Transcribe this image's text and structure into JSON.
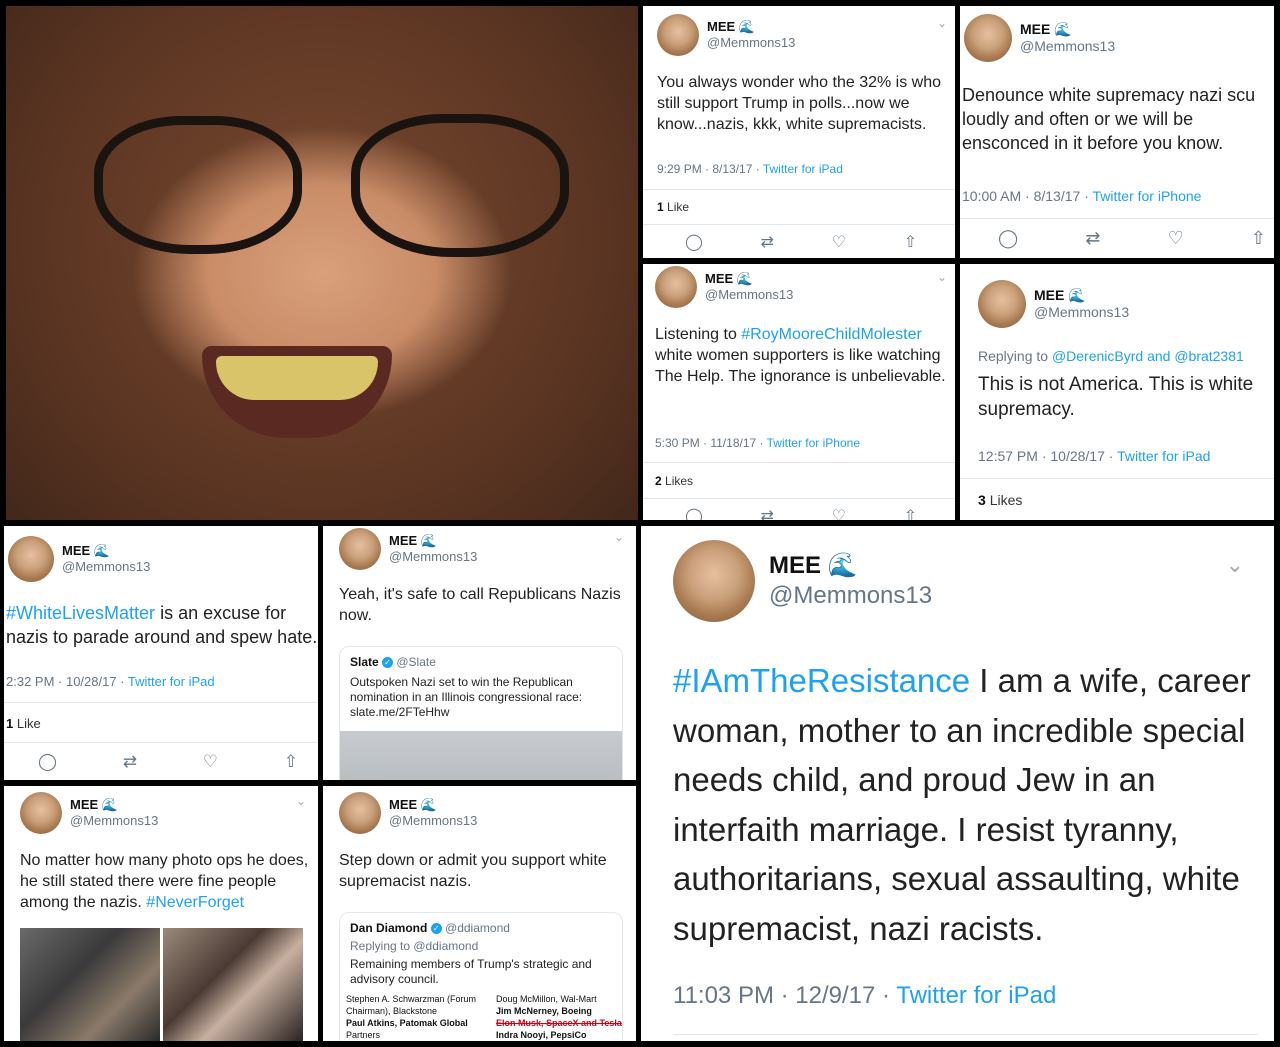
{
  "user": {
    "name": "MEE",
    "handle": "@Memmons13",
    "wave": "🌊"
  },
  "t1": {
    "text": "You always wonder who the 32% is who still support Trump in polls...now we know...nazis, kkk, white supremacists.",
    "time": "9:29 PM · 8/13/17 · ",
    "source": "Twitter for iPad",
    "likes_count": "1",
    "likes_label": "Like"
  },
  "t2": {
    "text": "Denounce white supremacy nazi scu loudly and often or we will be ensconced in it before you know.",
    "time": "10:00 AM · 8/13/17 · ",
    "source": "Twitter for iPhone"
  },
  "t3": {
    "tag": "#RoyMooreChildMolester",
    "pre": "Listening to ",
    "post": " white women supporters is like watching The Help. The ignorance is unbelievable.",
    "time": "5:30 PM · 11/18/17 · ",
    "source": "Twitter for iPhone",
    "likes_count": "2",
    "likes_label": "Likes"
  },
  "t4": {
    "reply_prefix": "Replying to ",
    "reply_to": "@DerenicByrd and @brat2381",
    "text": "This is not America. This is white supremacy.",
    "time": "12:57 PM · 10/28/17 · ",
    "source": "Twitter for iPad",
    "likes_count": "3",
    "likes_label": "Likes"
  },
  "t5": {
    "tag": "#WhiteLivesMatter",
    "post": " is an excuse for nazis to parade around and spew hate.",
    "time": "2:32 PM · 10/28/17 · ",
    "source": "Twitter for iPad",
    "likes_count": "1",
    "likes_label": "Like"
  },
  "t6": {
    "text": "Yeah, it's safe to call Republicans Nazis now.",
    "quote_name": "Slate",
    "quote_handle": "@Slate",
    "quote_text": "Outspoken Nazi set to win the Republican nomination in an Illinois congressional race: slate.me/2FTeHhw"
  },
  "t7": {
    "pre": "No matter how many photo ops he does, he still stated there were fine people among the nazis. ",
    "tag": "#NeverForget"
  },
  "t8": {
    "text": "Step down or admit you support white supremacist nazis.",
    "quote_name": "Dan Diamond",
    "quote_handle": "@ddiamond",
    "quote_reply": "Replying to @ddiamond",
    "quote_text": "Remaining members of Trump's strategic and advisory council.",
    "left_names": [
      "Stephen A. Schwarzman (Forum",
      "Chairman), Blackstone",
      "Paul Atkins, Patomak Global",
      "Partners"
    ],
    "right_names": [
      "Doug McMillon, Wal-Mart",
      "Jim McNerney, Boeing",
      "Elon Musk, SpaceX and Tesla",
      "Indra Nooyi, PepsiCo"
    ]
  },
  "t9": {
    "tag": "#IAmTheResistance",
    "post": " I am a wife, career woman, mother to an incredible special needs child, and proud Jew in an interfaith marriage.  I resist tyranny, authoritarians, sexual assaulting, white supremacist, nazi racists.",
    "time": "11:03 PM · 12/9/17 · ",
    "source": "Twitter for iPad"
  },
  "icons": [
    "reply-icon",
    "retweet-icon",
    "like-icon",
    "share-icon",
    "chevron-down-icon",
    "verified-icon"
  ]
}
